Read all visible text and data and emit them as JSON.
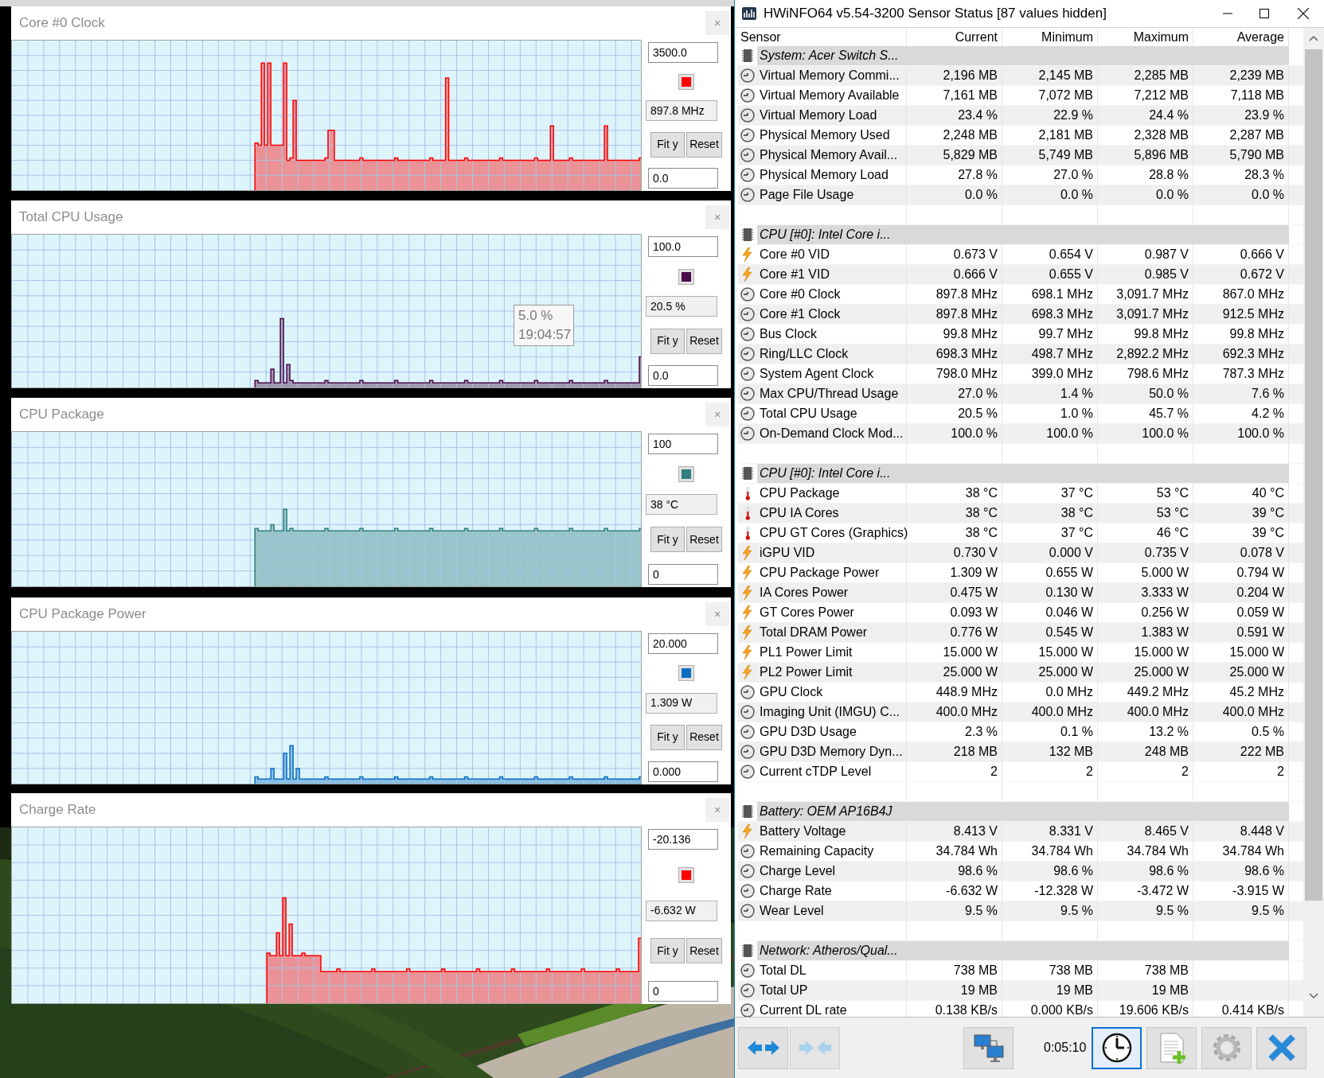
{
  "graphs": [
    {
      "title": "Core #0 Clock",
      "close": "×",
      "max": "3500.0",
      "current": "897.8 MHz",
      "min": "0.0",
      "fit": "Fit y",
      "reset": "Reset",
      "color": "#ff0000"
    },
    {
      "title": "Total CPU Usage",
      "close": "×",
      "max": "100.0",
      "current": "20.5 %",
      "min": "0.0",
      "fit": "Fit y",
      "reset": "Reset",
      "color": "#4a0a4a",
      "tooltip": {
        "value": "5.0 %",
        "time": "19:04:57"
      }
    },
    {
      "title": "CPU Package",
      "close": "×",
      "max": "100",
      "current": "38 °C",
      "min": "0",
      "fit": "Fit y",
      "reset": "Reset",
      "color": "#2f7f7f"
    },
    {
      "title": "CPU Package Power",
      "close": "×",
      "max": "20.000",
      "current": "1.309 W",
      "min": "0.000",
      "fit": "Fit y",
      "reset": "Reset",
      "color": "#0a6fc2"
    },
    {
      "title": "Charge Rate",
      "close": "×",
      "max": "-20.136",
      "current": "-6.632 W",
      "min": "0",
      "fit": "Fit y",
      "reset": "Reset",
      "color": "#ff0000"
    }
  ],
  "window": {
    "title": "HWiNFO64 v5.54-3200 Sensor Status [87 values hidden]"
  },
  "table": {
    "columns": [
      "Sensor",
      "Current",
      "Minimum",
      "Maximum",
      "Average"
    ],
    "rows": [
      {
        "kind": "group",
        "label": "System: Acer Switch S..."
      },
      {
        "kind": "clock",
        "label": "Virtual Memory Commi...",
        "current": "2,196 MB",
        "minimum": "2,145 MB",
        "maximum": "2,285 MB",
        "average": "2,239 MB"
      },
      {
        "kind": "clock",
        "label": "Virtual Memory Available",
        "current": "7,161 MB",
        "minimum": "7,072 MB",
        "maximum": "7,212 MB",
        "average": "7,118 MB"
      },
      {
        "kind": "clock",
        "label": "Virtual Memory Load",
        "current": "23.4 %",
        "minimum": "22.9 %",
        "maximum": "24.4 %",
        "average": "23.9 %"
      },
      {
        "kind": "clock",
        "label": "Physical Memory Used",
        "current": "2,248 MB",
        "minimum": "2,181 MB",
        "maximum": "2,328 MB",
        "average": "2,287 MB"
      },
      {
        "kind": "clock",
        "label": "Physical Memory Avail...",
        "current": "5,829 MB",
        "minimum": "5,749 MB",
        "maximum": "5,896 MB",
        "average": "5,790 MB"
      },
      {
        "kind": "clock",
        "label": "Physical Memory Load",
        "current": "27.8 %",
        "minimum": "27.0 %",
        "maximum": "28.8 %",
        "average": "28.3 %"
      },
      {
        "kind": "clock",
        "label": "Page File Usage",
        "current": "0.0 %",
        "minimum": "0.0 %",
        "maximum": "0.0 %",
        "average": "0.0 %"
      },
      {
        "kind": "blank"
      },
      {
        "kind": "group",
        "label": "CPU [#0]: Intel Core i..."
      },
      {
        "kind": "bolt",
        "label": "Core #0 VID",
        "current": "0.673 V",
        "minimum": "0.654 V",
        "maximum": "0.987 V",
        "average": "0.666 V"
      },
      {
        "kind": "bolt",
        "label": "Core #1 VID",
        "current": "0.666 V",
        "minimum": "0.655 V",
        "maximum": "0.985 V",
        "average": "0.672 V"
      },
      {
        "kind": "clock",
        "label": "Core #0 Clock",
        "current": "897.8 MHz",
        "minimum": "698.1 MHz",
        "maximum": "3,091.7 MHz",
        "average": "867.0 MHz"
      },
      {
        "kind": "clock",
        "label": "Core #1 Clock",
        "current": "897.8 MHz",
        "minimum": "698.3 MHz",
        "maximum": "3,091.7 MHz",
        "average": "912.5 MHz"
      },
      {
        "kind": "clock",
        "label": "Bus Clock",
        "current": "99.8 MHz",
        "minimum": "99.7 MHz",
        "maximum": "99.8 MHz",
        "average": "99.8 MHz"
      },
      {
        "kind": "clock",
        "label": "Ring/LLC Clock",
        "current": "698.3 MHz",
        "minimum": "498.7 MHz",
        "maximum": "2,892.2 MHz",
        "average": "692.3 MHz"
      },
      {
        "kind": "clock",
        "label": "System Agent Clock",
        "current": "798.0 MHz",
        "minimum": "399.0 MHz",
        "maximum": "798.6 MHz",
        "average": "787.3 MHz"
      },
      {
        "kind": "clock",
        "label": "Max CPU/Thread Usage",
        "current": "27.0 %",
        "minimum": "1.4 %",
        "maximum": "50.0 %",
        "average": "7.6 %"
      },
      {
        "kind": "clock",
        "label": "Total CPU Usage",
        "current": "20.5 %",
        "minimum": "1.0 %",
        "maximum": "45.7 %",
        "average": "4.2 %"
      },
      {
        "kind": "clock",
        "label": "On-Demand Clock Mod...",
        "current": "100.0 %",
        "minimum": "100.0 %",
        "maximum": "100.0 %",
        "average": "100.0 %"
      },
      {
        "kind": "blank"
      },
      {
        "kind": "group",
        "label": "CPU [#0]: Intel Core i..."
      },
      {
        "kind": "thermo",
        "label": "CPU Package",
        "current": "38 °C",
        "minimum": "37 °C",
        "maximum": "53 °C",
        "average": "40 °C"
      },
      {
        "kind": "thermo",
        "label": "CPU IA Cores",
        "current": "38 °C",
        "minimum": "38 °C",
        "maximum": "53 °C",
        "average": "39 °C"
      },
      {
        "kind": "thermo",
        "label": "CPU GT Cores (Graphics)",
        "current": "38 °C",
        "minimum": "37 °C",
        "maximum": "46 °C",
        "average": "39 °C"
      },
      {
        "kind": "bolt",
        "label": "iGPU VID",
        "current": "0.730 V",
        "minimum": "0.000 V",
        "maximum": "0.735 V",
        "average": "0.078 V"
      },
      {
        "kind": "bolt",
        "label": "CPU Package Power",
        "current": "1.309 W",
        "minimum": "0.655 W",
        "maximum": "5.000 W",
        "average": "0.794 W"
      },
      {
        "kind": "bolt",
        "label": "IA Cores Power",
        "current": "0.475 W",
        "minimum": "0.130 W",
        "maximum": "3.333 W",
        "average": "0.204 W"
      },
      {
        "kind": "bolt",
        "label": "GT Cores Power",
        "current": "0.093 W",
        "minimum": "0.046 W",
        "maximum": "0.256 W",
        "average": "0.059 W"
      },
      {
        "kind": "bolt",
        "label": "Total DRAM Power",
        "current": "0.776 W",
        "minimum": "0.545 W",
        "maximum": "1.383 W",
        "average": "0.591 W"
      },
      {
        "kind": "bolt",
        "label": "PL1 Power Limit",
        "current": "15.000 W",
        "minimum": "15.000 W",
        "maximum": "15.000 W",
        "average": "15.000 W"
      },
      {
        "kind": "bolt",
        "label": "PL2 Power Limit",
        "current": "25.000 W",
        "minimum": "25.000 W",
        "maximum": "25.000 W",
        "average": "25.000 W"
      },
      {
        "kind": "clock",
        "label": "GPU Clock",
        "current": "448.9 MHz",
        "minimum": "0.0 MHz",
        "maximum": "449.2 MHz",
        "average": "45.2 MHz"
      },
      {
        "kind": "clock",
        "label": "Imaging Unit (IMGU) C...",
        "current": "400.0 MHz",
        "minimum": "400.0 MHz",
        "maximum": "400.0 MHz",
        "average": "400.0 MHz"
      },
      {
        "kind": "clock",
        "label": "GPU D3D Usage",
        "current": "2.3 %",
        "minimum": "0.1 %",
        "maximum": "13.2 %",
        "average": "0.5 %"
      },
      {
        "kind": "clock",
        "label": "GPU D3D Memory Dyn...",
        "current": "218 MB",
        "minimum": "132 MB",
        "maximum": "248 MB",
        "average": "222 MB"
      },
      {
        "kind": "clock",
        "label": "Current cTDP Level",
        "current": "2",
        "minimum": "2",
        "maximum": "2",
        "average": "2"
      },
      {
        "kind": "blank"
      },
      {
        "kind": "group",
        "label": "Battery: OEM AP16B4J"
      },
      {
        "kind": "bolt",
        "label": "Battery Voltage",
        "current": "8.413 V",
        "minimum": "8.331 V",
        "maximum": "8.465 V",
        "average": "8.448 V"
      },
      {
        "kind": "clock",
        "label": "Remaining Capacity",
        "current": "34.784 Wh",
        "minimum": "34.784 Wh",
        "maximum": "34.784 Wh",
        "average": "34.784 Wh"
      },
      {
        "kind": "clock",
        "label": "Charge Level",
        "current": "98.6 %",
        "minimum": "98.6 %",
        "maximum": "98.6 %",
        "average": "98.6 %"
      },
      {
        "kind": "clock",
        "label": "Charge Rate",
        "current": "-6.632 W",
        "minimum": "-12.328 W",
        "maximum": "-3.472 W",
        "average": "-3.915 W"
      },
      {
        "kind": "clock",
        "label": "Wear Level",
        "current": "9.5 %",
        "minimum": "9.5 %",
        "maximum": "9.5 %",
        "average": "9.5 %"
      },
      {
        "kind": "blank"
      },
      {
        "kind": "group",
        "label": "Network: Atheros/Qual..."
      },
      {
        "kind": "clock",
        "label": "Total DL",
        "current": "738 MB",
        "minimum": "738 MB",
        "maximum": "738 MB"
      },
      {
        "kind": "clock",
        "label": "Total UP",
        "current": "19 MB",
        "minimum": "19 MB",
        "maximum": "19 MB"
      },
      {
        "kind": "clock",
        "label": "Current DL rate",
        "current": "0.138 KB/s",
        "minimum": "0.000 KB/s",
        "maximum": "19.606 KB/s",
        "average": "0.414 KB/s"
      }
    ]
  },
  "toolbar": {
    "time": "0:05:10",
    "buttons": [
      {
        "kind": "expand",
        "selected": false,
        "disabled": false
      },
      {
        "kind": "collapse",
        "selected": false,
        "disabled": true
      },
      {
        "kind": "network",
        "selected": false,
        "disabled": false
      },
      {
        "kind": "clock",
        "selected": true,
        "disabled": false
      },
      {
        "kind": "report",
        "selected": false,
        "disabled": false
      },
      {
        "kind": "settings",
        "selected": false,
        "disabled": false
      },
      {
        "kind": "close",
        "selected": false,
        "disabled": false
      }
    ]
  }
}
